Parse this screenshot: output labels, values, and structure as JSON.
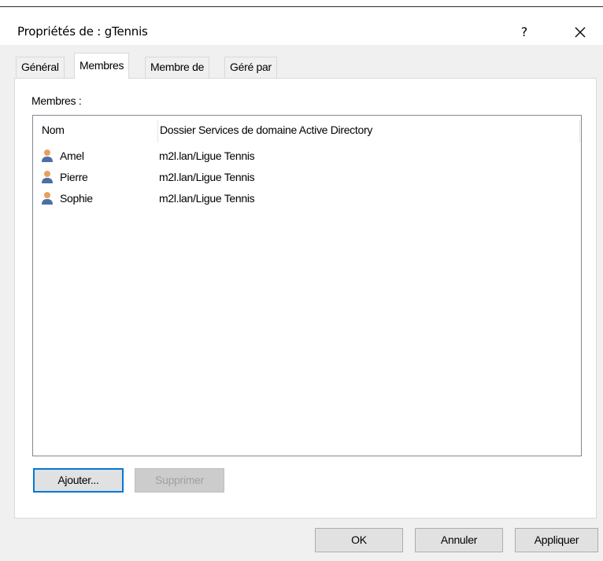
{
  "window": {
    "title": "Propriétés de : gTennis",
    "help_label": "?"
  },
  "tabs": [
    {
      "label": "Général",
      "active": false
    },
    {
      "label": "Membres",
      "active": true
    },
    {
      "label": "Membre de",
      "active": false
    },
    {
      "label": "Géré par",
      "active": false
    }
  ],
  "members_panel": {
    "group_label": "Membres :",
    "columns": [
      "Nom",
      "Dossier Services de domaine Active Directory"
    ],
    "rows": [
      {
        "name": "Amel",
        "folder": "m2l.lan/Ligue Tennis",
        "icon": "user-icon"
      },
      {
        "name": "Pierre",
        "folder": "m2l.lan/Ligue Tennis",
        "icon": "user-icon"
      },
      {
        "name": "Sophie",
        "folder": "m2l.lan/Ligue Tennis",
        "icon": "user-icon"
      }
    ],
    "add_button": "Ajouter...",
    "remove_button": "Supprimer"
  },
  "footer": {
    "ok_button": "OK",
    "cancel_button": "Annuler",
    "apply_button": "Appliquer"
  },
  "colors": {
    "dialog_bg": "#f0f0f0",
    "focus_border": "#0078d7",
    "user_icon_head": "#e8a060",
    "user_icon_body": "#4a6fa5"
  }
}
